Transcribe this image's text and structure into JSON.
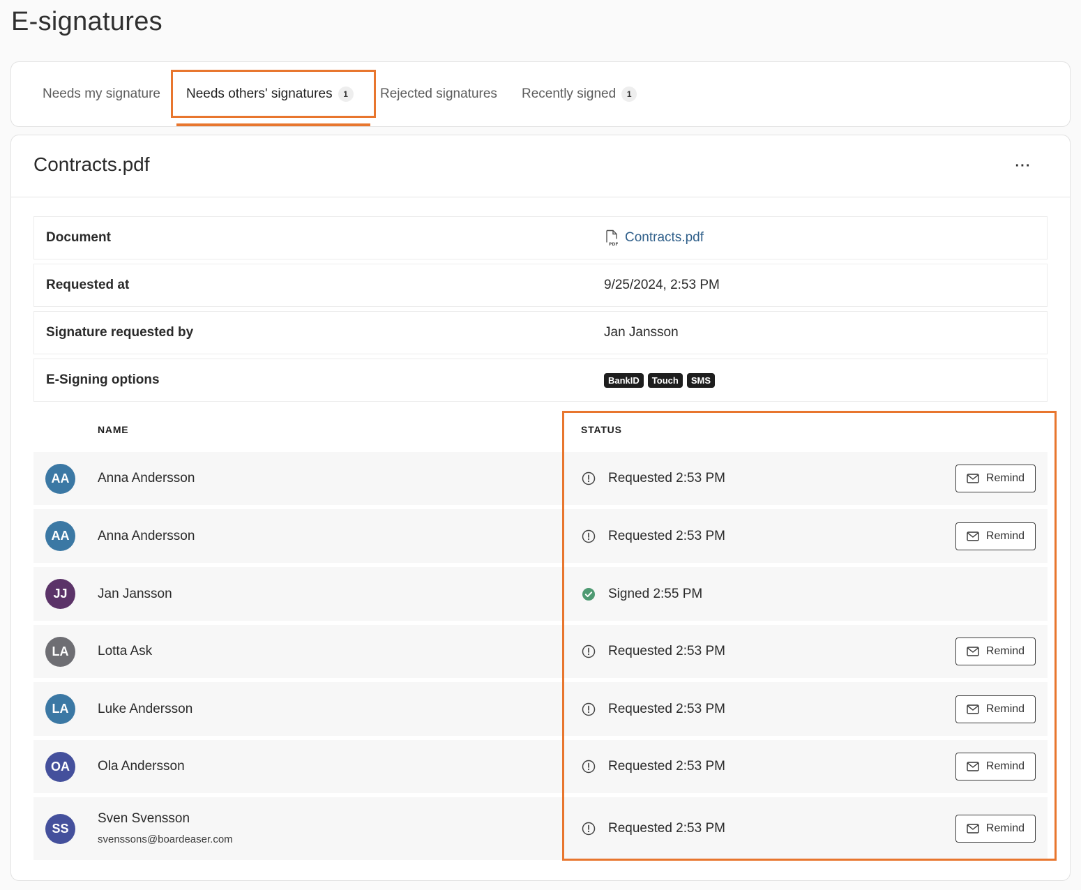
{
  "page": {
    "title": "E-signatures"
  },
  "tabs": [
    {
      "label": "Needs my signature",
      "count": null,
      "active": false
    },
    {
      "label": "Needs others' signatures",
      "count": "1",
      "active": true
    },
    {
      "label": "Rejected signatures",
      "count": null,
      "active": false
    },
    {
      "label": "Recently signed",
      "count": "1",
      "active": false
    }
  ],
  "document": {
    "title": "Contracts.pdf",
    "more_label": "···",
    "info": {
      "document_label": "Document",
      "document_value": "Contracts.pdf",
      "requested_at_label": "Requested at",
      "requested_at_value": "9/25/2024, 2:53 PM",
      "requested_by_label": "Signature requested by",
      "requested_by_value": "Jan Jansson",
      "options_label": "E-Signing options",
      "options": [
        "BankID",
        "Touch",
        "SMS"
      ]
    }
  },
  "table": {
    "headers": {
      "name": "NAME",
      "status": "STATUS"
    },
    "remind_label": "Remind",
    "rows": [
      {
        "initials": "AA",
        "name": "Anna Andersson",
        "email": "",
        "status": "Requested 2:53 PM",
        "signed": false,
        "avatar_color": "#3b78a4"
      },
      {
        "initials": "AA",
        "name": "Anna Andersson",
        "email": "",
        "status": "Requested 2:53 PM",
        "signed": false,
        "avatar_color": "#3b78a4"
      },
      {
        "initials": "JJ",
        "name": "Jan Jansson",
        "email": "",
        "status": "Signed 2:55 PM",
        "signed": true,
        "avatar_color": "#5b3368"
      },
      {
        "initials": "LA",
        "name": "Lotta Ask",
        "email": "",
        "status": "Requested 2:53 PM",
        "signed": false,
        "avatar_color": "#6e6e73"
      },
      {
        "initials": "LA",
        "name": "Luke Andersson",
        "email": "",
        "status": "Requested 2:53 PM",
        "signed": false,
        "avatar_color": "#3b78a4"
      },
      {
        "initials": "OA",
        "name": "Ola Andersson",
        "email": "",
        "status": "Requested 2:53 PM",
        "signed": false,
        "avatar_color": "#44509c"
      },
      {
        "initials": "SS",
        "name": "Sven Svensson",
        "email": "svenssons@boardeaser.com",
        "status": "Requested 2:53 PM",
        "signed": false,
        "avatar_color": "#44509c"
      }
    ]
  },
  "colors": {
    "accent": "#e8762e",
    "signed": "#4e9a72",
    "badge_bg": "#1e1e1e",
    "link": "#2f5f8a"
  }
}
